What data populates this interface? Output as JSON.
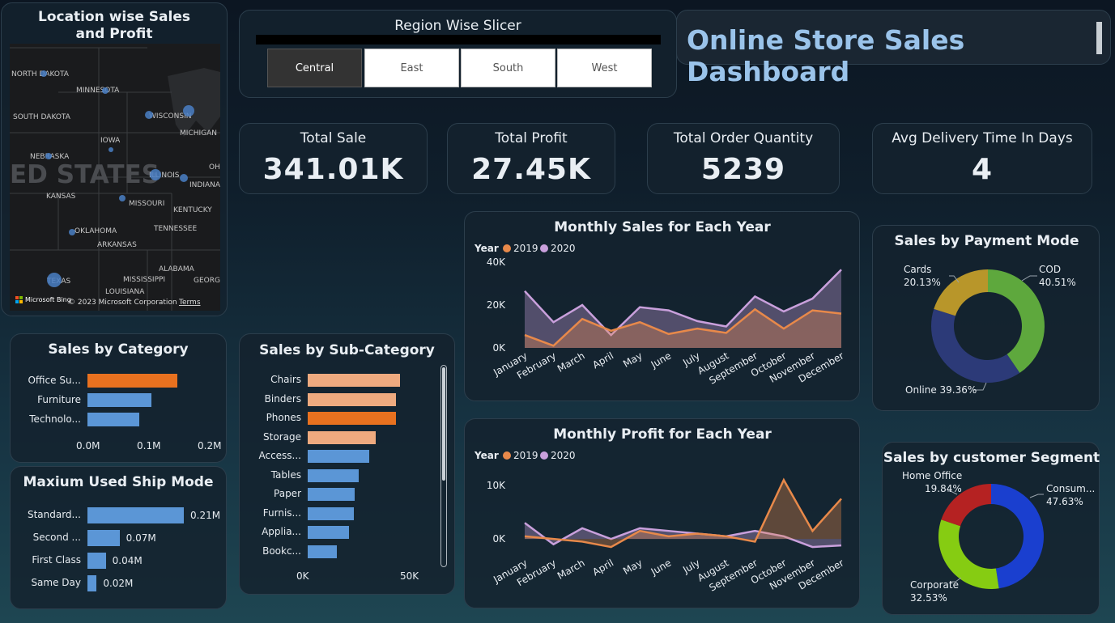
{
  "dashboard_title": "Online Store Sales Dashboard",
  "slicer": {
    "title": "Region Wise Slicer",
    "options": [
      "Central",
      "East",
      "South",
      "West"
    ],
    "selected": "Central"
  },
  "map": {
    "title": "Location wise Sales and Profit",
    "state_labels": [
      "NORTH DAKOTA",
      "MINNESOTA",
      "SOUTH DAKOTA",
      "WISCONSIN",
      "MICHIGAN",
      "IOWA",
      "NEBRASKA",
      "ILLINOIS",
      "INDIANA",
      "OH",
      "KANSAS",
      "MISSOURI",
      "KENTUCKY",
      "OKLAHOMA",
      "TENNESSEE",
      "ARKANSAS",
      "ALABAMA",
      "MISSISSIPPI",
      "GEORG",
      "TEXAS",
      "LOUISIANA"
    ],
    "country_label": "ED STATES",
    "attribution_brand": "Microsoft Bing",
    "copyright": "© 2023 Microsoft Corporation",
    "terms": "Terms"
  },
  "kpis": [
    {
      "label": "Total Sale",
      "value": "341.01K"
    },
    {
      "label": "Total Profit",
      "value": "27.45K"
    },
    {
      "label": "Total Order Quantity",
      "value": "5239"
    },
    {
      "label": "Avg Delivery Time In Days",
      "value": "4"
    }
  ],
  "category_chart": {
    "title": "Sales by Category",
    "categories": [
      "Office Su...",
      "Furniture",
      "Technolo..."
    ],
    "values": [
      0.148,
      0.105,
      0.085
    ],
    "highlight_index": 0,
    "ticks": [
      "0.0M",
      "0.1M",
      "0.2M"
    ],
    "xlim": [
      0,
      0.2
    ]
  },
  "ship_chart": {
    "title": "Maxium Used Ship Mode",
    "categories": [
      "Standard...",
      "Second ...",
      "First Class",
      "Same Day"
    ],
    "values": [
      0.21,
      0.07,
      0.04,
      0.02
    ],
    "labels": [
      "0.21M",
      "0.07M",
      "0.04M",
      "0.02M"
    ]
  },
  "subcategory_chart": {
    "title": "Sales by Sub-Category",
    "categories": [
      "Chairs",
      "Binders",
      "Phones",
      "Storage",
      "Access...",
      "Tables",
      "Paper",
      "Furnis...",
      "Applia...",
      "Bookc..."
    ],
    "values": [
      49,
      46.5,
      46.5,
      36,
      32.5,
      27,
      25,
      24.5,
      22,
      15.5
    ],
    "ticks": [
      "0K",
      "50K"
    ],
    "xlim": [
      0,
      57
    ]
  },
  "chart_data": [
    {
      "type": "area",
      "title": "Monthly Sales for Each Year",
      "legend_title": "Year",
      "categories": [
        "January",
        "February",
        "March",
        "April",
        "May",
        "June",
        "July",
        "August",
        "September",
        "October",
        "November",
        "December"
      ],
      "series": [
        {
          "name": "2019",
          "color": "#e8894a",
          "values": [
            6000,
            1000,
            13500,
            8000,
            12000,
            6500,
            9000,
            7000,
            18000,
            9000,
            17500,
            16000
          ]
        },
        {
          "name": "2020",
          "color": "#c9a0dc",
          "values": [
            26500,
            12000,
            20000,
            6000,
            19000,
            17500,
            12500,
            10000,
            24000,
            17000,
            23000,
            36500
          ]
        }
      ],
      "yticks": [
        "0K",
        "20K",
        "40K"
      ],
      "ylim": [
        0,
        40000
      ]
    },
    {
      "type": "area",
      "title": "Monthly Profit for Each Year",
      "legend_title": "Year",
      "categories": [
        "January",
        "February",
        "March",
        "April",
        "May",
        "June",
        "July",
        "August",
        "September",
        "October",
        "November",
        "December"
      ],
      "series": [
        {
          "name": "2019",
          "color": "#e8894a",
          "values": [
            500,
            0,
            -500,
            -1500,
            1500,
            500,
            1000,
            500,
            -500,
            11000,
            1500,
            7500
          ]
        },
        {
          "name": "2020",
          "color": "#c9a0dc",
          "values": [
            3000,
            -1000,
            2000,
            0,
            2000,
            1500,
            1000,
            500,
            1500,
            500,
            -1500,
            -1200
          ]
        }
      ],
      "yticks": [
        "0K",
        "10K"
      ],
      "ylim": [
        -3000,
        13000
      ]
    },
    {
      "type": "pie",
      "title": "Sales by Payment Mode",
      "slices": [
        {
          "name": "COD",
          "pct": "40.51%",
          "value": 40.51,
          "color": "#5ea83d"
        },
        {
          "name": "Online",
          "pct": "39.36%",
          "value": 39.36,
          "color": "#2c3a78"
        },
        {
          "name": "Cards",
          "pct": "20.13%",
          "value": 20.13,
          "color": "#b8962a"
        }
      ]
    },
    {
      "type": "pie",
      "title": "Sales by customer Segment",
      "slices": [
        {
          "name": "Consum...",
          "pct": "47.63%",
          "value": 47.63,
          "color": "#1a3fcf"
        },
        {
          "name": "Corporate",
          "pct": "32.53%",
          "value": 32.53,
          "color": "#86cc12"
        },
        {
          "name": "Home Office",
          "pct": "19.84%",
          "value": 19.84,
          "color": "#b52222"
        }
      ]
    }
  ]
}
